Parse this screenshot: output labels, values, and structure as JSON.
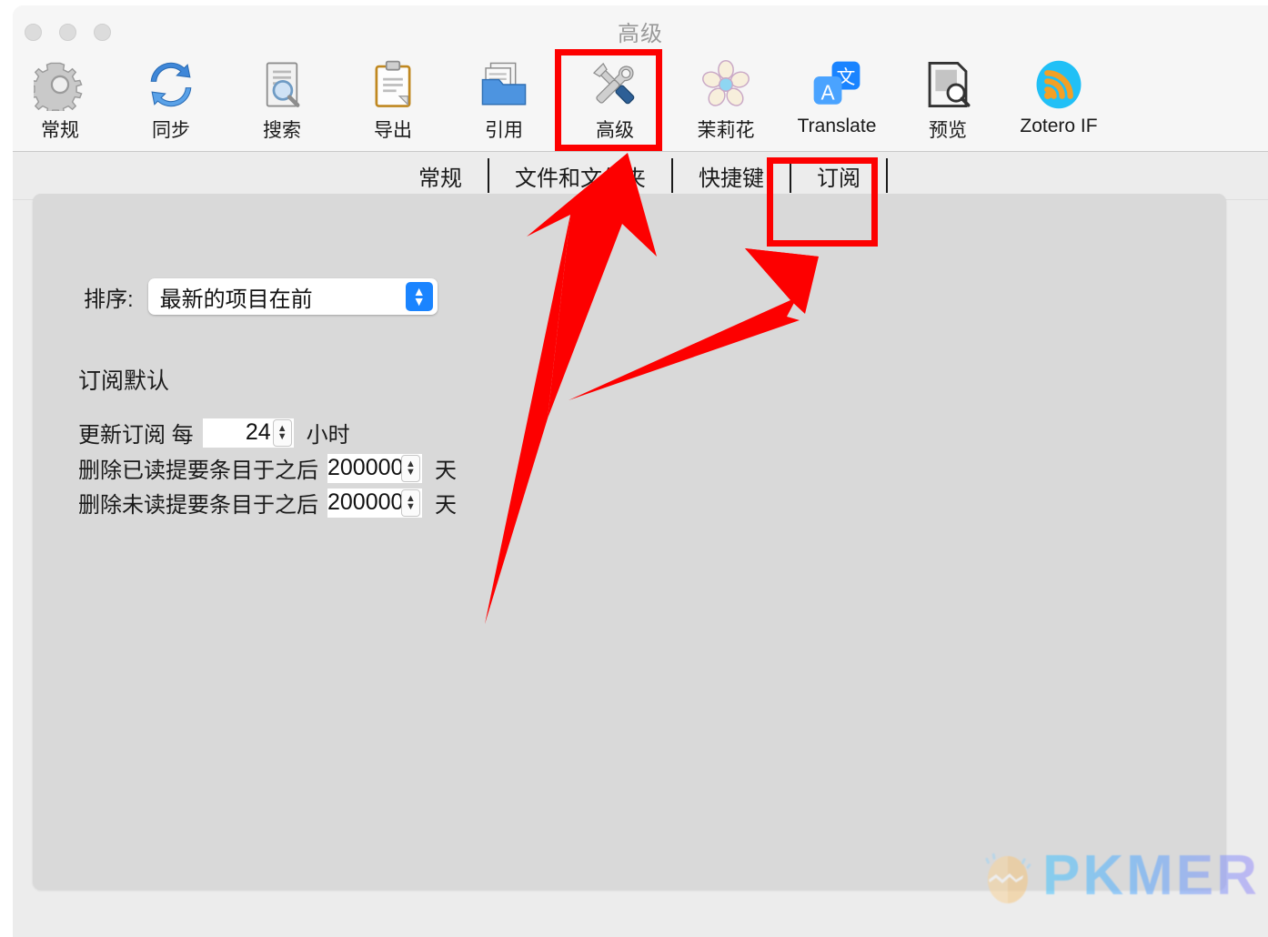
{
  "window": {
    "title": "高级",
    "traffic_lights": [
      "close-button",
      "minimize-button",
      "zoom-button"
    ]
  },
  "toolbar": {
    "items": [
      {
        "label": "常规",
        "icon": "gear-icon"
      },
      {
        "label": "同步",
        "icon": "sync-arrows-icon"
      },
      {
        "label": "搜索",
        "icon": "document-magnifier-icon"
      },
      {
        "label": "导出",
        "icon": "clipboard-icon"
      },
      {
        "label": "引用",
        "icon": "folder-documents-icon"
      },
      {
        "label": "高级",
        "icon": "wrench-screwdriver-icon"
      },
      {
        "label": "茉莉花",
        "icon": "jasmine-flower-icon"
      },
      {
        "label": "Translate",
        "icon": "translate-icon"
      },
      {
        "label": "预览",
        "icon": "preview-magnifier-icon"
      },
      {
        "label": "Zotero IF",
        "icon": "rss-feed-icon"
      }
    ],
    "selected": "高级"
  },
  "tabs": {
    "items": [
      "常规",
      "文件和文件夹",
      "快捷键",
      "订阅"
    ],
    "selected": "订阅"
  },
  "content": {
    "sort": {
      "label": "排序:",
      "value": "最新的项目在前"
    },
    "section_title": "订阅默认",
    "rows": [
      {
        "prefix": "更新订阅 每",
        "value": "24",
        "suffix": "小时"
      },
      {
        "prefix": "删除已读提要条目于之后",
        "value": "200000",
        "suffix": "天"
      },
      {
        "prefix": "删除未读提要条目于之后",
        "value": "200000",
        "suffix": "天"
      }
    ]
  },
  "watermark": {
    "text": "PKMER",
    "logo": "cracked-egg-icon"
  },
  "annotations": {
    "highlight_color": "#fd0000",
    "boxes": [
      "toolbar-item-advanced",
      "tab-subscriptions"
    ],
    "arrows": 2
  }
}
